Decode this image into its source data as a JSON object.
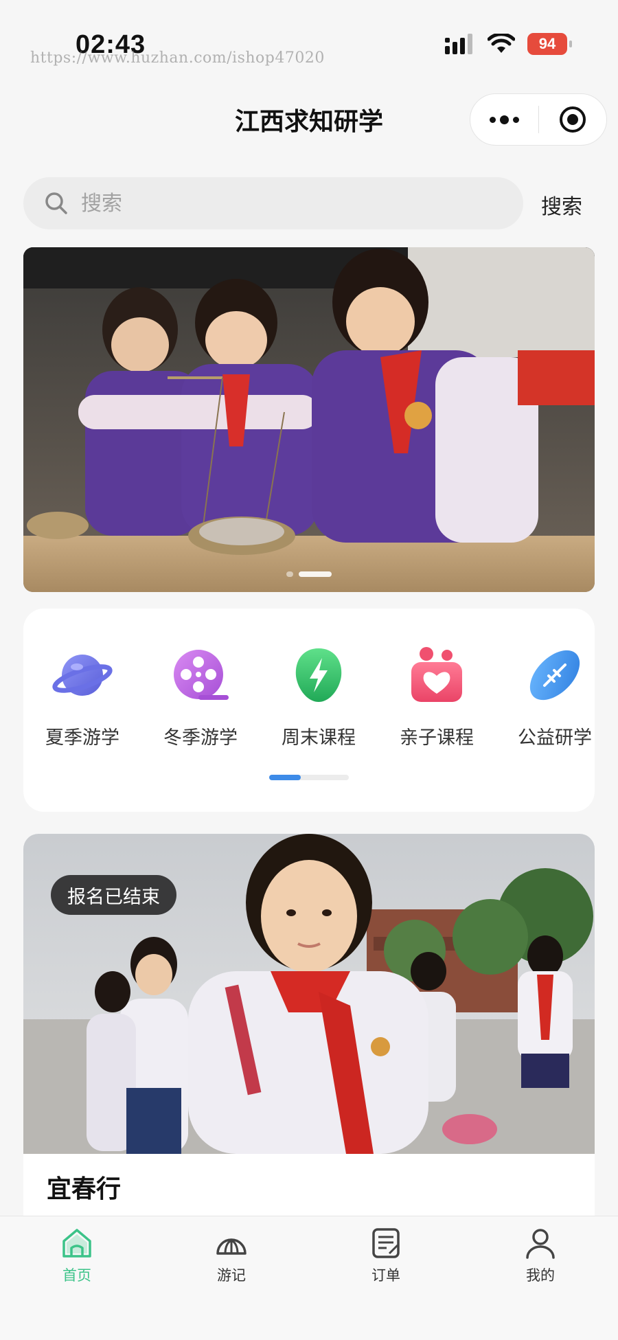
{
  "status_bar": {
    "time": "02:43",
    "watermark": "https://www.huzhan.com/ishop47020",
    "battery": "94"
  },
  "nav": {
    "title": "江西求知研学"
  },
  "search": {
    "placeholder": "搜索",
    "button_label": "搜索"
  },
  "banner": {
    "slides": 2,
    "active_index": 1
  },
  "categories": [
    {
      "label": "夏季游学",
      "icon": "planet-icon",
      "color": "#6b72e8"
    },
    {
      "label": "冬季游学",
      "icon": "film-reel-icon",
      "color": "#b45fe0"
    },
    {
      "label": "周末课程",
      "icon": "lightning-bolt-icon",
      "color": "#33c46a"
    },
    {
      "label": "亲子课程",
      "icon": "family-heart-icon",
      "color": "#f2557a"
    },
    {
      "label": "公益研学",
      "icon": "rugby-ball-icon",
      "color": "#3a8fe8"
    }
  ],
  "category_scroll_progress": 0.4,
  "trip": {
    "badge": "报名已结束",
    "title": "宜春行"
  },
  "tabs": [
    {
      "label": "首页",
      "icon": "home-icon",
      "active": true
    },
    {
      "label": "游记",
      "icon": "travel-notes-icon",
      "active": false
    },
    {
      "label": "订单",
      "icon": "order-icon",
      "active": false
    },
    {
      "label": "我的",
      "icon": "profile-icon",
      "active": false
    }
  ],
  "colors": {
    "accent_green": "#3cc389",
    "scroll_blue": "#3d8be8",
    "badge_dark": "#1e1e1e"
  }
}
